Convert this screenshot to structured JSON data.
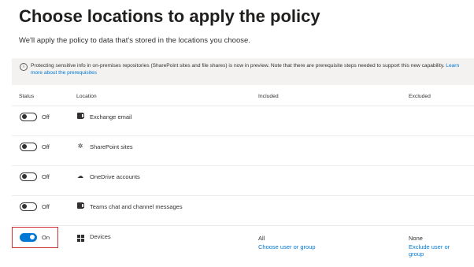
{
  "page": {
    "title": "Choose locations to apply the policy",
    "subtitle": "We'll apply the policy to data that's stored in the locations you choose."
  },
  "info_bar": {
    "icon": "info-icon",
    "text": "Protecting sensitive info in on-premises repositories (SharePoint sites and file shares) is now in preview. Note that there are prerequisite steps needed to support this new capability.",
    "link": "Learn more about the prerequisites"
  },
  "table": {
    "headers": {
      "status": "Status",
      "location": "Location",
      "included": "Included",
      "excluded": "Excluded"
    },
    "rows": [
      {
        "status": "Off",
        "enabled": false,
        "icon": "exchange-icon",
        "location": "Exchange email",
        "included": "",
        "included_link": "",
        "excluded": "",
        "excluded_link": ""
      },
      {
        "status": "Off",
        "enabled": false,
        "icon": "sharepoint-icon",
        "location": "SharePoint sites",
        "included": "",
        "included_link": "",
        "excluded": "",
        "excluded_link": ""
      },
      {
        "status": "Off",
        "enabled": false,
        "icon": "onedrive-icon",
        "location": "OneDrive accounts",
        "included": "",
        "included_link": "",
        "excluded": "",
        "excluded_link": ""
      },
      {
        "status": "Off",
        "enabled": false,
        "icon": "teams-icon",
        "location": "Teams chat and channel messages",
        "included": "",
        "included_link": "",
        "excluded": "",
        "excluded_link": ""
      },
      {
        "status": "On",
        "enabled": true,
        "icon": "windows-devices-icon",
        "location": "Devices",
        "included": "All",
        "included_link": "Choose user or group",
        "excluded": "None",
        "excluded_link": "Exclude user or group"
      }
    ]
  },
  "colors": {
    "accent": "#0078d4",
    "highlight_border": "#d13438",
    "info_background": "#f3f2f1"
  }
}
